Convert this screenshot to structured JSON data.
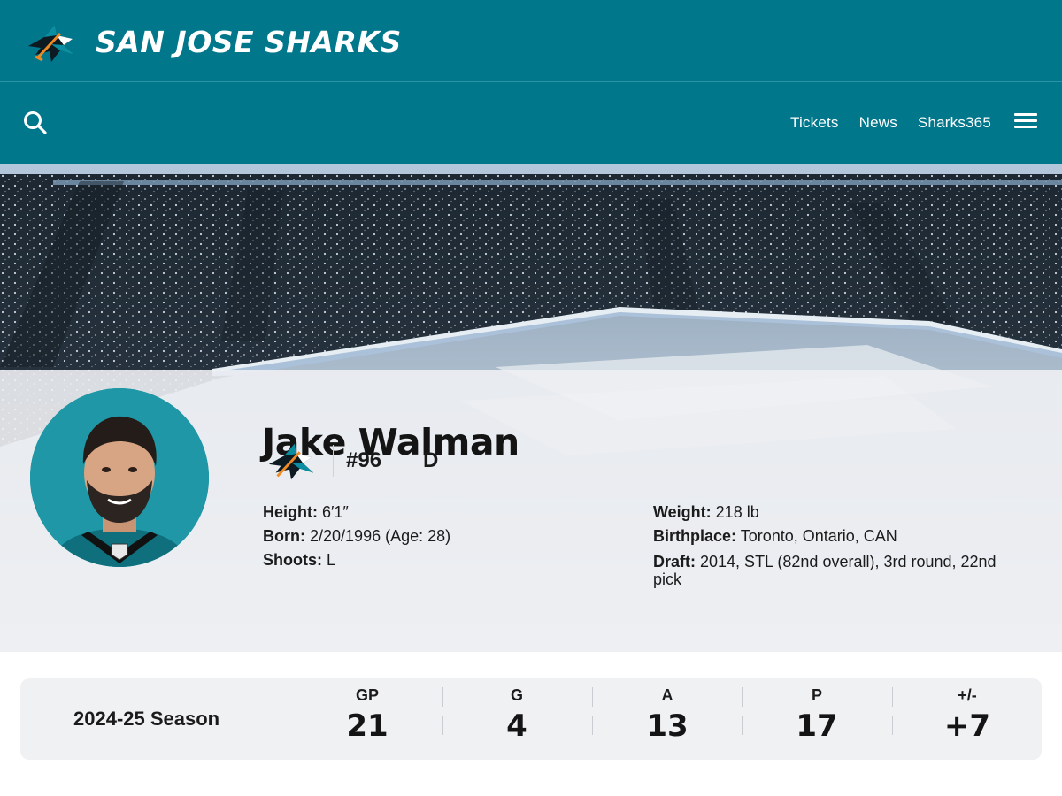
{
  "header": {
    "title": "SAN JOSE SHARKS",
    "logo_icon": "sharks-logo-icon",
    "brand_color": "#01778c"
  },
  "nav": {
    "search_icon": "search-icon",
    "links": [
      "Tickets",
      "News",
      "Sharks365"
    ],
    "menu_icon": "hamburger-menu-icon"
  },
  "player": {
    "name": "Jake Walman",
    "number": "#96",
    "position": "D",
    "bio_left": [
      {
        "label": "Height:",
        "value": "6′1″"
      },
      {
        "label": "Born:",
        "value": "2/20/1996 (Age: 28)"
      },
      {
        "label": "Shoots:",
        "value": "L"
      }
    ],
    "bio_right": [
      {
        "label": "Weight:",
        "value": "218 lb"
      },
      {
        "label": "Birthplace:",
        "value": "Toronto, Ontario, CAN"
      },
      {
        "label": "Draft:",
        "value": "2014, STL (82nd overall), 3rd round, 22nd pick"
      }
    ]
  },
  "stats": {
    "season": "2024-25 Season",
    "columns": [
      {
        "label": "GP",
        "value": "21"
      },
      {
        "label": "G",
        "value": "4"
      },
      {
        "label": "A",
        "value": "13"
      },
      {
        "label": "P",
        "value": "17"
      },
      {
        "label": "+/-",
        "value": "+7"
      }
    ]
  }
}
